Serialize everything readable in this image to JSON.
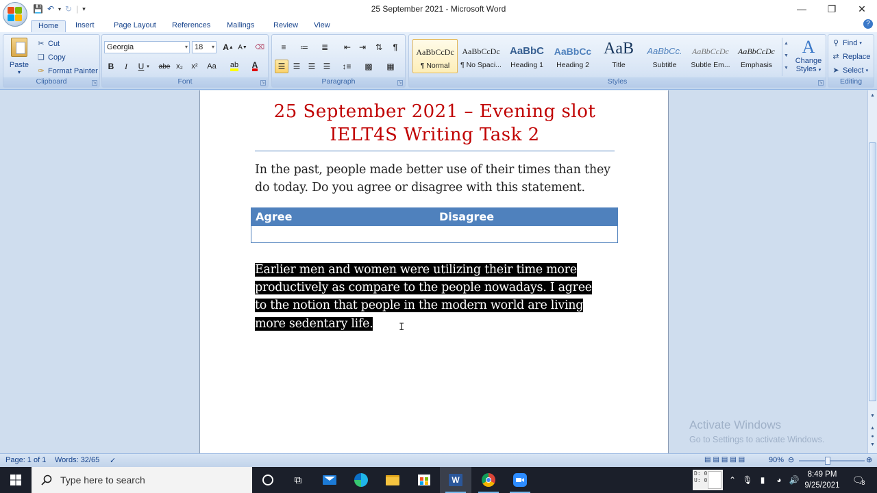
{
  "window": {
    "title": "25 September 2021 - Microsoft Word"
  },
  "tabs": [
    "Home",
    "Insert",
    "Page Layout",
    "References",
    "Mailings",
    "Review",
    "View"
  ],
  "clipboard": {
    "paste": "Paste",
    "cut": "Cut",
    "copy": "Copy",
    "format_painter": "Format Painter",
    "label": "Clipboard"
  },
  "font": {
    "name": "Georgia",
    "size": "18",
    "label": "Font",
    "bold": "B",
    "italic": "I",
    "underline": "U",
    "strike": "abe",
    "subscript": "x₂",
    "superscript": "x²",
    "change_case": "Aa",
    "grow": "A",
    "shrink": "A"
  },
  "paragraph": {
    "label": "Paragraph"
  },
  "styles": {
    "label": "Styles",
    "items": [
      {
        "sample": "AaBbCcDc",
        "name": "¶ Normal"
      },
      {
        "sample": "AaBbCcDc",
        "name": "¶ No Spaci..."
      },
      {
        "sample": "AaBbC",
        "name": "Heading 1"
      },
      {
        "sample": "AaBbCc",
        "name": "Heading 2"
      },
      {
        "sample": "AaB",
        "name": "Title"
      },
      {
        "sample": "AaBbCc.",
        "name": "Subtitle"
      },
      {
        "sample": "AaBbCcDc",
        "name": "Subtle Em..."
      },
      {
        "sample": "AaBbCcDc",
        "name": "Emphasis"
      }
    ],
    "change_styles_line1": "Change",
    "change_styles_line2": "Styles"
  },
  "editing": {
    "label": "Editing",
    "find": "Find",
    "replace": "Replace",
    "select": "Select"
  },
  "document": {
    "title_line1": "25 September 2021 – Evening slot",
    "title_line2": "IELT4S Writing Task 2",
    "prompt": "In the past, people made better use of their times than they do today. Do you agree or disagree with this statement.",
    "table": {
      "col1": "Agree",
      "col2": "Disagree"
    },
    "essay": "Earlier men and women were utilizing their time more productively as compare to the people nowadays. I agree to the notion that people in the modern world are living more sedentary life."
  },
  "status": {
    "page": "Page: 1 of 1",
    "words": "Words: 32/65",
    "zoom": "90%"
  },
  "watermark": {
    "line1": "Activate Windows",
    "line2": "Go to Settings to activate Windows."
  },
  "taskbar": {
    "search_placeholder": "Type here to search",
    "time": "8:49 PM",
    "date": "9/25/2021",
    "ime_text": "D: 0\nU: 0",
    "notification_count": "8"
  },
  "colors": {
    "title_red": "#c00000",
    "table_header": "#4f81bd",
    "taskbar": "#1b1f2a"
  }
}
